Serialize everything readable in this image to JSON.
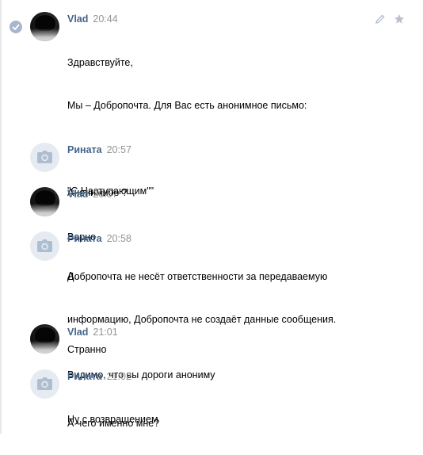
{
  "messages": [
    {
      "author": "Vlad",
      "time": "20:44",
      "lines": [
        "Здравствуйте,",
        "Мы – Добропочта. Для Вас есть анонимное письмо:",
        "",
        "\"С Наступающим\"\"",
        "___",
        "Добропочта не несёт ответственности за передаваемую",
        "информацию, Добропочта не создаёт данные сообщения."
      ]
    },
    {
      "author": "Рината",
      "time": "20:57",
      "lines": [
        "Анонимное ?"
      ]
    },
    {
      "author": "Vlad",
      "time": "20:57",
      "lines": [
        "Верно"
      ]
    },
    {
      "author": "Рината",
      "time": "20:58",
      "lines": [
        "А..",
        "",
        "Странно",
        "",
        "А чего именно мне?"
      ]
    },
    {
      "author": "Vlad",
      "time": "21:01",
      "lines": [
        "Видимо, что вы дороги анониму"
      ]
    },
    {
      "author": "Рината",
      "time": "21:02",
      "lines": [
        "Ну с возвращением"
      ]
    }
  ],
  "icons": {
    "selected": "check-circle-icon",
    "edit": "pencil-icon",
    "important": "star-icon",
    "no_photo": "camera-icon"
  },
  "colors": {
    "author": "#42648b",
    "time": "#939393",
    "avatar_placeholder": "#e5ebf1",
    "check": "#a6b7cc"
  }
}
